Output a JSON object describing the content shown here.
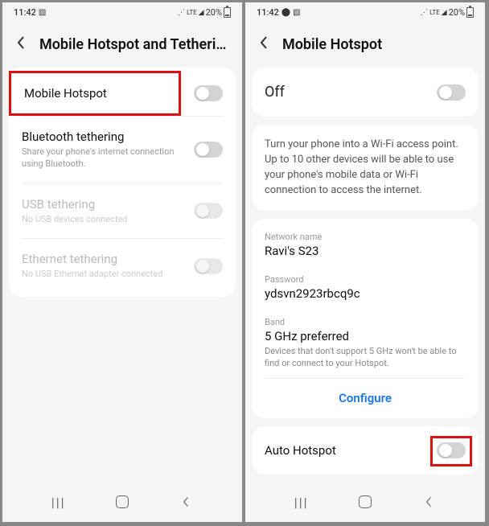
{
  "statusbar": {
    "time": "11:42",
    "battery_pct": "20%"
  },
  "left": {
    "title": "Mobile Hotspot and Tetheri…",
    "items": {
      "hotspot": {
        "label": "Mobile Hotspot"
      },
      "bt": {
        "label": "Bluetooth tethering",
        "sub": "Share your phone's internet connection using Bluetooth."
      },
      "usb": {
        "label": "USB tethering",
        "sub": "No USB devices connected"
      },
      "eth": {
        "label": "Ethernet tethering",
        "sub": "No USB Ethernet adapter connected"
      }
    }
  },
  "right": {
    "title": "Mobile Hotspot",
    "status": "Off",
    "description": "Turn your phone into a Wi-Fi access point. Up to 10 other devices will be able to use your phone's mobile data or Wi-Fi connection to access the internet.",
    "network_name_label": "Network name",
    "network_name": "Ravi's S23",
    "password_label": "Password",
    "password": "ydsvn2923rbcq9c",
    "band_label": "Band",
    "band": "5 GHz preferred",
    "band_sub": "Devices that don't support 5 GHz won't be able to find or connect to your Hotspot.",
    "configure": "Configure",
    "auto_hotspot": "Auto Hotspot"
  }
}
